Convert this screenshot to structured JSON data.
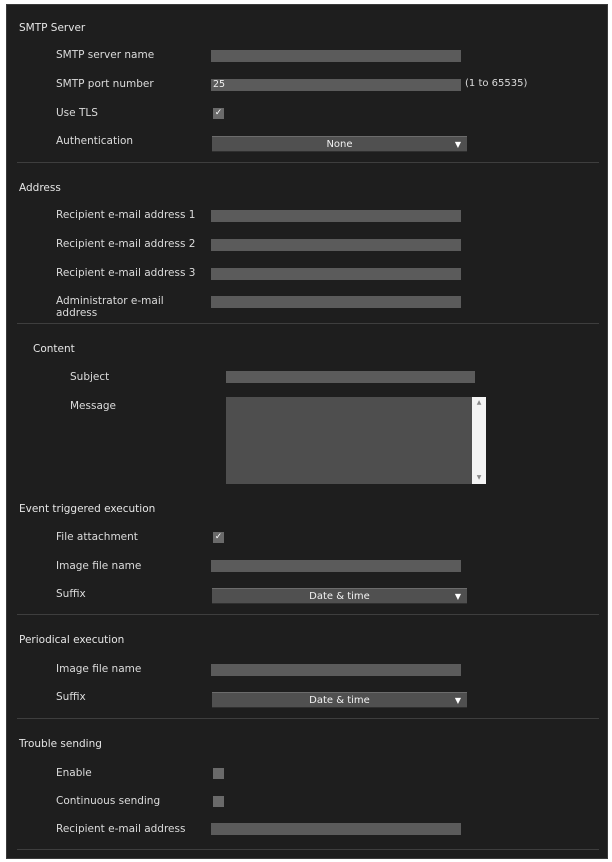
{
  "smtp": {
    "title": "SMTP Server",
    "server_name_label": "SMTP server name",
    "server_name_value": "",
    "port_label": "SMTP port number",
    "port_value": "25",
    "port_hint": "(1 to 65535)",
    "tls_label": "Use TLS",
    "tls_checked": "✓",
    "auth_label": "Authentication",
    "auth_value": "None"
  },
  "address": {
    "title": "Address",
    "recipient1_label": "Recipient e-mail address 1",
    "recipient2_label": "Recipient e-mail address 2",
    "recipient3_label": "Recipient e-mail address 3",
    "admin_label_line1": "Administrator e-mail",
    "admin_label_line2": "address"
  },
  "content": {
    "title": "Content",
    "subject_label": "Subject",
    "message_label": "Message"
  },
  "event": {
    "title": "Event triggered execution",
    "file_attachment_label": "File attachment",
    "file_attachment_checked": "✓",
    "image_file_name_label": "Image file name",
    "suffix_label": "Suffix",
    "suffix_value": "Date & time"
  },
  "periodical": {
    "title": "Periodical execution",
    "image_file_name_label": "Image file name",
    "suffix_label": "Suffix",
    "suffix_value": "Date & time"
  },
  "trouble": {
    "title": "Trouble sending",
    "enable_label": "Enable",
    "continuous_label": "Continuous sending",
    "recipient_label": "Recipient e-mail address"
  },
  "icons": {
    "dropdown": "▼",
    "scroll_up": "▲",
    "scroll_down": "▼"
  },
  "colors": {
    "panel_bg": "#1e1e1e",
    "field_bg": "#5b5b5b",
    "text": "#dcdcdc"
  }
}
